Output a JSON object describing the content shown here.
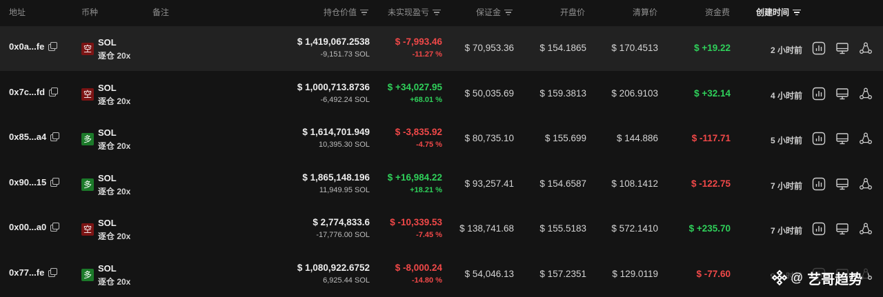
{
  "headers": {
    "address": "地址",
    "coin": "币种",
    "note": "备注",
    "position_value": "持仓价值",
    "unrealized_pnl": "未实现盈亏",
    "margin": "保证金",
    "entry_price": "开盘价",
    "liq_price": "清算价",
    "funding": "资金费",
    "created": "创建时间"
  },
  "rows": [
    {
      "address": "0x0a...fe",
      "side": "空",
      "side_type": "short",
      "coin": "SOL",
      "leverage": "逐仓 20x",
      "value": "$ 1,419,067.2538",
      "size": "-9,151.73 SOL",
      "pnl": "$ -7,993.46",
      "pnl_pct": "-11.27 %",
      "pnl_dir": "red",
      "margin": "$ 70,953.36",
      "entry": "$ 154.1865",
      "liq": "$ 170.4513",
      "funding": "$ +19.22",
      "funding_dir": "green",
      "time": "2 小时前"
    },
    {
      "address": "0x7c...fd",
      "side": "空",
      "side_type": "short",
      "coin": "SOL",
      "leverage": "逐仓 20x",
      "value": "$ 1,000,713.8736",
      "size": "-6,492.24 SOL",
      "pnl": "$ +34,027.95",
      "pnl_pct": "+68.01 %",
      "pnl_dir": "green",
      "margin": "$ 50,035.69",
      "entry": "$ 159.3813",
      "liq": "$ 206.9103",
      "funding": "$ +32.14",
      "funding_dir": "green",
      "time": "4 小时前"
    },
    {
      "address": "0x85...a4",
      "side": "多",
      "side_type": "long",
      "coin": "SOL",
      "leverage": "逐仓 20x",
      "value": "$ 1,614,701.949",
      "size": "10,395.30 SOL",
      "pnl": "$ -3,835.92",
      "pnl_pct": "-4.75 %",
      "pnl_dir": "red",
      "margin": "$ 80,735.10",
      "entry": "$ 155.699",
      "liq": "$ 144.886",
      "funding": "$ -117.71",
      "funding_dir": "red",
      "time": "5 小时前"
    },
    {
      "address": "0x90...15",
      "side": "多",
      "side_type": "long",
      "coin": "SOL",
      "leverage": "逐仓 20x",
      "value": "$ 1,865,148.196",
      "size": "11,949.95 SOL",
      "pnl": "$ +16,984.22",
      "pnl_pct": "+18.21 %",
      "pnl_dir": "green",
      "margin": "$ 93,257.41",
      "entry": "$ 154.6587",
      "liq": "$ 108.1412",
      "funding": "$ -122.75",
      "funding_dir": "red",
      "time": "7 小时前"
    },
    {
      "address": "0x00...a0",
      "side": "空",
      "side_type": "short",
      "coin": "SOL",
      "leverage": "逐仓 20x",
      "value": "$ 2,774,833.6",
      "size": "-17,776.00 SOL",
      "pnl": "$ -10,339.53",
      "pnl_pct": "-7.45 %",
      "pnl_dir": "red",
      "margin": "$ 138,741.68",
      "entry": "$ 155.5183",
      "liq": "$ 572.1410",
      "funding": "$ +235.70",
      "funding_dir": "green",
      "time": "7 小时前"
    },
    {
      "address": "0x77...fe",
      "side": "多",
      "side_type": "long",
      "coin": "SOL",
      "leverage": "逐仓 20x",
      "value": "$ 1,080,922.6752",
      "size": "6,925.44 SOL",
      "pnl": "$ -8,000.24",
      "pnl_pct": "-14.80 %",
      "pnl_dir": "red",
      "margin": "$ 54,046.13",
      "entry": "$ 157.2351",
      "liq": "$ 129.0119",
      "funding": "$ -77.60",
      "funding_dir": "red",
      "time": "9 小时前"
    }
  ],
  "watermark": {
    "at": "@",
    "text": "艺哥趋势"
  },
  "colors": {
    "background": "#141414",
    "row_highlight": "#222222",
    "red": "#f04848",
    "green": "#2fd05a",
    "short_badge": "#7b1414",
    "long_badge": "#1c7a2a"
  }
}
